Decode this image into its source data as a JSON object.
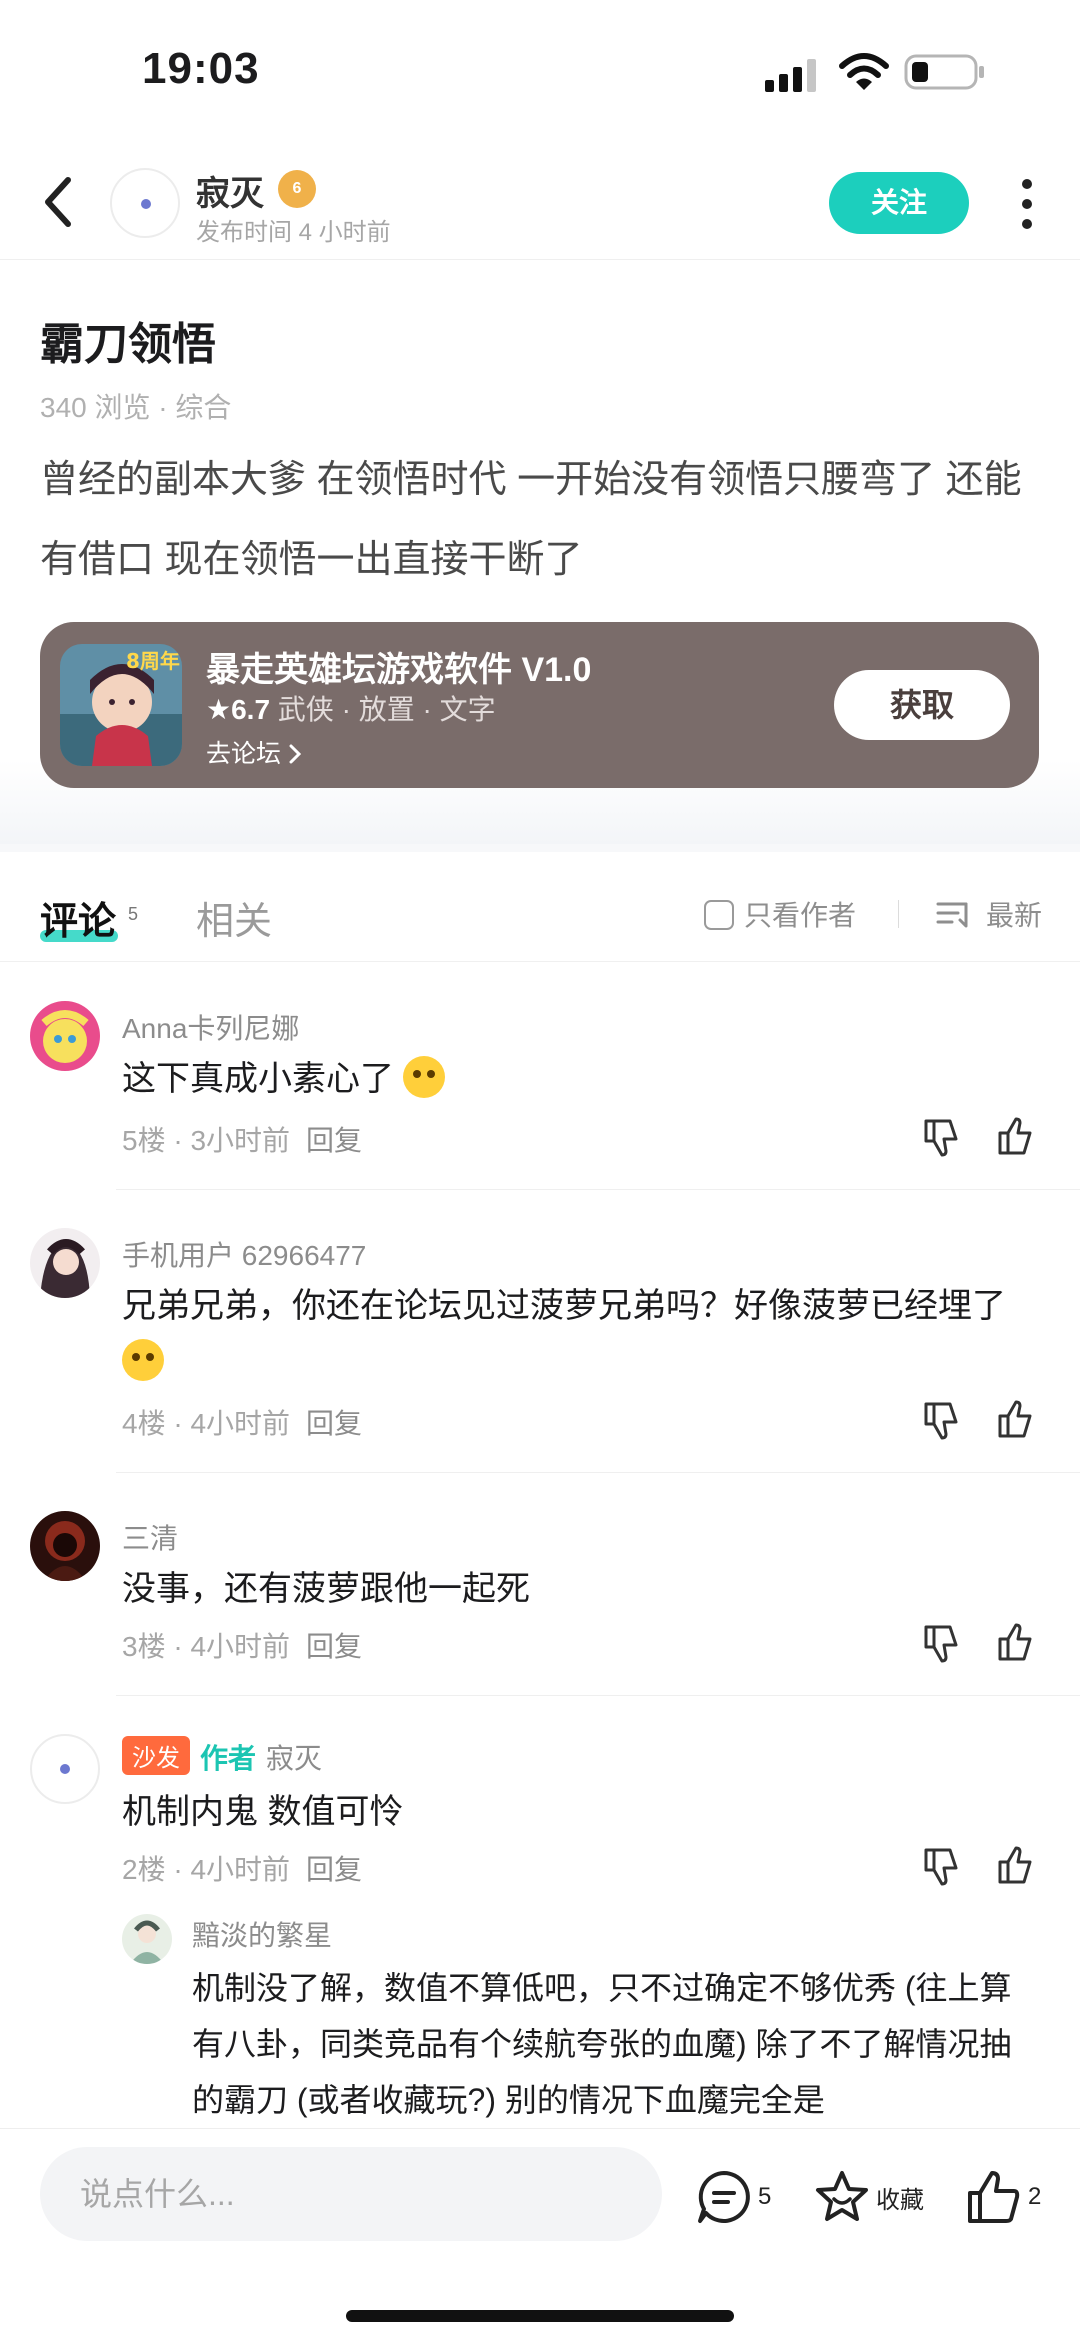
{
  "status_bar": {
    "time": "19:03"
  },
  "header": {
    "author_name": "寂灭",
    "level_badge": "6",
    "publish_time": "发布时间 4 小时前",
    "follow_label": "关注"
  },
  "post": {
    "title": "霸刀领悟",
    "meta": "340 浏览 · 综合",
    "body": "曾经的副本大爹  在领悟时代 一开始没有领悟只腰弯了  还能有借口  现在领悟一出直接干断了"
  },
  "game_card": {
    "name": "暴走英雄坛游戏软件 V1.0",
    "rating": "★6.7",
    "tags": " 武侠 · 放置 · 文字",
    "forum_link": "去论坛",
    "get_label": "获取",
    "icon_badge": "8周年"
  },
  "tabs": {
    "comments_label": "评论",
    "comments_count": "5",
    "related_label": "相关",
    "author_only_label": "只看作者",
    "sort_label": "最新"
  },
  "comments": [
    {
      "user": "Anna卡列尼娜",
      "text": "这下真成小素心了",
      "floor": "5楼 · 3小时前",
      "reply": "回复"
    },
    {
      "user": "手机用户 62966477",
      "text": "兄弟兄弟，你还在论坛见过菠萝兄弟吗？好像菠萝已经埋了",
      "floor": "4楼 · 4小时前",
      "reply": "回复"
    },
    {
      "user": "三清",
      "text": "没事，还有菠萝跟他一起死",
      "floor": "3楼 · 4小时前",
      "reply": "回复"
    },
    {
      "sofa": "沙发",
      "author_tag": "作者",
      "user": "寂灭",
      "text": "机制内鬼 数值可怜",
      "floor": "2楼 · 4小时前",
      "reply": "回复",
      "sub_reply": {
        "user": "黯淡的繁星",
        "text": "机制没了解，数值不算低吧，只不过确定不够优秀 (往上算有八卦，同类竞品有个续航夸张的血魔) 除了不了解情况抽的霸刀 (或者收藏玩?) 别的情况下血魔完全是"
      }
    }
  ],
  "bottom_bar": {
    "input_placeholder": "说点什么...",
    "comment_count": "5",
    "favorite_label": "收藏",
    "like_count": "2"
  }
}
